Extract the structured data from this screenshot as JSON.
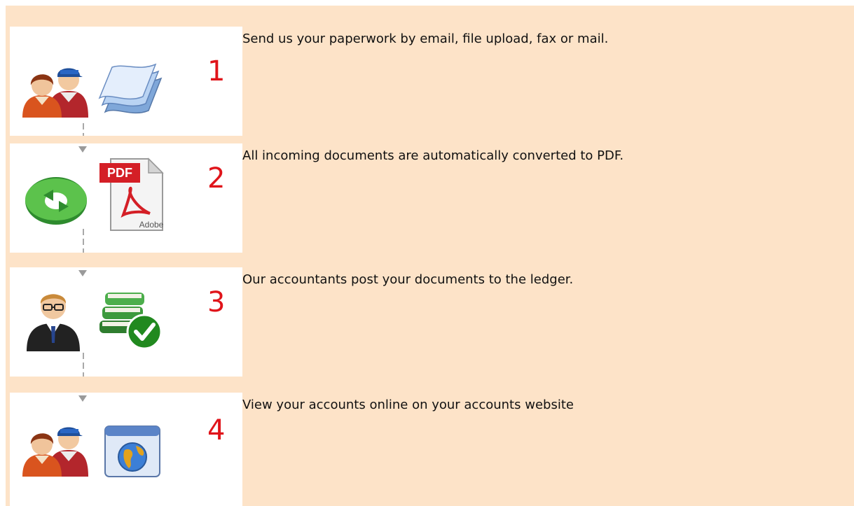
{
  "steps": [
    {
      "number": "1",
      "text": "Send us your paperwork by email, file upload, fax or mail.",
      "icons": [
        "users-icon",
        "paper-stack-icon"
      ]
    },
    {
      "number": "2",
      "text": "All incoming documents are automatically converted to PDF.",
      "icons": [
        "refresh-icon",
        "pdf-file-icon"
      ],
      "pdf_badge": "PDF",
      "pdf_caption": "Adobe"
    },
    {
      "number": "3",
      "text": "Our accountants post your documents to the ledger.",
      "icons": [
        "accountant-icon",
        "books-check-icon"
      ]
    },
    {
      "number": "4",
      "text": "View your accounts online on your accounts website",
      "icons": [
        "users-icon",
        "globe-window-icon"
      ]
    }
  ],
  "colors": {
    "background": "#fde3c8",
    "panel": "#ffffff",
    "number": "#e0141a",
    "connector": "#a9a9a9"
  }
}
